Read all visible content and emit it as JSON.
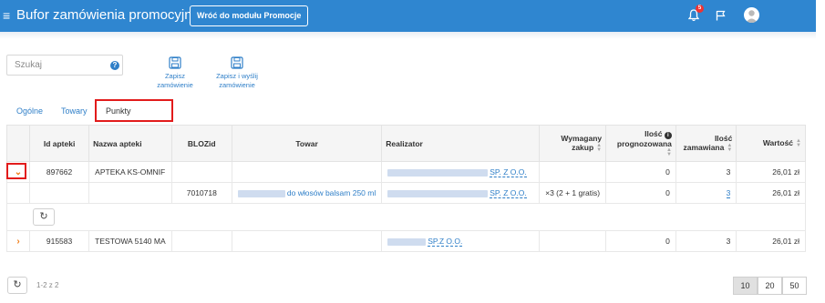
{
  "header": {
    "menu_glyph": "≡",
    "title": "Bufor zamówienia promocyjnego",
    "back_button": "Wróć do modułu Promocje",
    "notification_count": "5",
    "accent": "#2f86d0"
  },
  "toolbar": {
    "search_placeholder": "Szukaj",
    "help_glyph": "?",
    "save_order": "Zapisz zamówienie",
    "save_send_line1": "Zapisz i wyślij",
    "save_send_line2": "zamówienie"
  },
  "tabs": [
    "Ogólne",
    "Towary",
    "Punkty sprzedaży"
  ],
  "table": {
    "headers": {
      "id": "Id apteki",
      "name": "Nazwa apteki",
      "bloz": "BLOZid",
      "product": "Towar",
      "supplier": "Realizator",
      "required_l1": "Wymagany",
      "required_l2": "zakup",
      "forecast_l1": "Ilość",
      "forecast_l2": "prognozowana",
      "ordered_l1": "Ilość",
      "ordered_l2": "zamawiana",
      "value": "Wartość"
    },
    "rows": [
      {
        "chevron": "⌄",
        "id": "897662",
        "name": "APTEKA KS-OMNIF",
        "bloz": "",
        "product": "",
        "supplier": "SP. Z O.O.",
        "required": "",
        "forecast": "0",
        "ordered": "3",
        "value": "26,01 zł"
      },
      {
        "chevron": "",
        "id": "",
        "name": "",
        "bloz": "7010718",
        "product": "do włosów balsam 250 ml",
        "supplier": "SP. Z O.O.",
        "required": "×3 (2 + 1 gratis)",
        "forecast": "0",
        "ordered": "3",
        "value": "26,01 zł"
      },
      {
        "chevron": "›",
        "id": "915583",
        "name": "TESTOWA 5140 MA",
        "bloz": "",
        "product": "",
        "supplier": "SP.Z O.O.",
        "required": "",
        "forecast": "0",
        "ordered": "3",
        "value": "26,01 zł"
      }
    ],
    "refresh_glyph": "↻"
  },
  "pager": {
    "info": "1-2 z 2",
    "sizes": [
      "10",
      "20",
      "50"
    ],
    "selected": "10"
  }
}
